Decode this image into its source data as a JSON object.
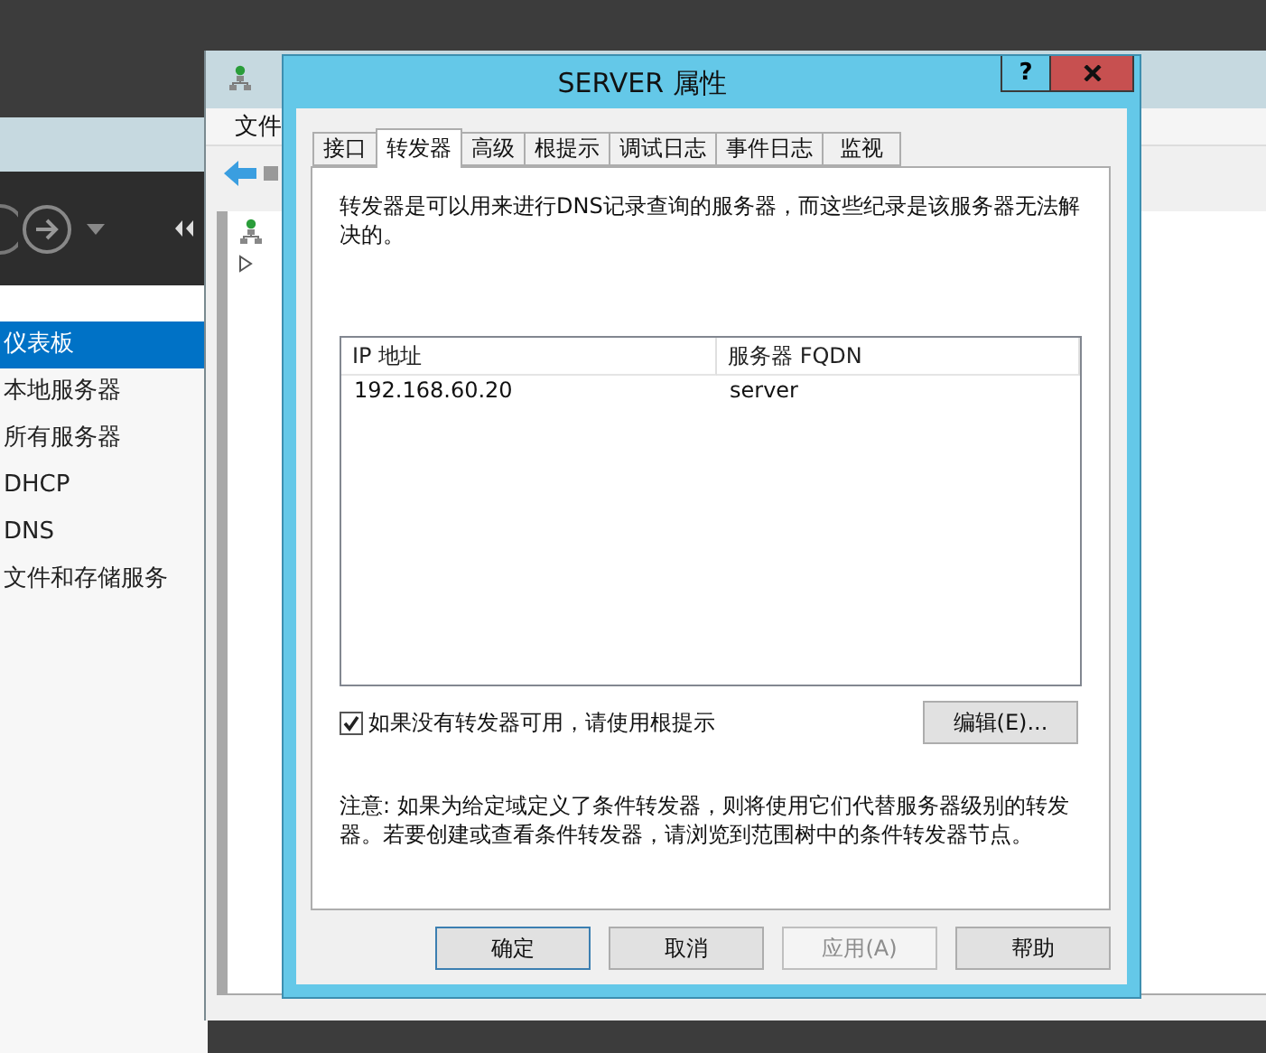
{
  "server_manager": {
    "sidebar": {
      "items": [
        {
          "label": "仪表板",
          "selected": true
        },
        {
          "label": "本地服务器",
          "selected": false
        },
        {
          "label": "所有服务器",
          "selected": false
        },
        {
          "label": "DHCP",
          "selected": false
        },
        {
          "label": "DNS",
          "selected": false
        },
        {
          "label": "文件和存储服务",
          "selected": false
        }
      ]
    }
  },
  "dns_manager": {
    "menu": [
      "文件"
    ]
  },
  "dialog": {
    "title": "SERVER 属性",
    "help_button": "?",
    "tabs": [
      {
        "label": "接口",
        "selected": false
      },
      {
        "label": "转发器",
        "selected": true
      },
      {
        "label": "高级",
        "selected": false
      },
      {
        "label": "根提示",
        "selected": false
      },
      {
        "label": "调试日志",
        "selected": false
      },
      {
        "label": "事件日志",
        "selected": false
      },
      {
        "label": "监视",
        "selected": false
      }
    ],
    "description": "转发器是可以用来进行DNS记录查询的服务器，而这些纪录是该服务器无法解决的。",
    "list": {
      "columns": [
        "IP 地址",
        "服务器 FQDN"
      ],
      "rows": [
        [
          "192.168.60.20",
          "server"
        ]
      ]
    },
    "use_root_hints": {
      "label": "如果没有转发器可用，请使用根提示",
      "checked": true
    },
    "edit_button": "编辑(E)...",
    "note": "注意: 如果为给定域定义了条件转发器，则将使用它们代替服务器级别的转发器。若要创建或查看条件转发器，请浏览到范围树中的条件转发器节点。",
    "buttons": [
      {
        "label": "确定",
        "default": true,
        "disabled": false
      },
      {
        "label": "取消",
        "default": false,
        "disabled": false
      },
      {
        "label": "应用(A)",
        "default": false,
        "disabled": true
      },
      {
        "label": "帮助",
        "default": false,
        "disabled": false
      }
    ]
  }
}
